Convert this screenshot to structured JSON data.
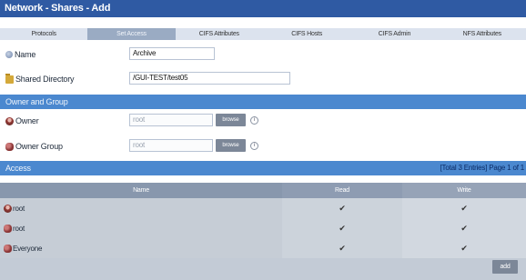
{
  "title": "Network - Shares - Add",
  "tabs": [
    {
      "label": "Protocols"
    },
    {
      "label": "Set Access"
    },
    {
      "label": "CIFS Attributes"
    },
    {
      "label": "CIFS Hosts"
    },
    {
      "label": "CIFS Admin"
    },
    {
      "label": "NFS Attributes"
    }
  ],
  "form": {
    "name_label": "Name",
    "name_value": "Archive",
    "dir_label": "Shared Directory",
    "dir_value": "/GUI-TEST/test05"
  },
  "owner_section": {
    "title": "Owner and Group",
    "owner_label": "Owner",
    "owner_value": "root",
    "group_label": "Owner Group",
    "group_value": "root",
    "browse_label": "browse"
  },
  "access": {
    "title": "Access",
    "summary": "[Total 3 Entries] Page 1 of 1",
    "columns": {
      "name": "Name",
      "read": "Read",
      "write": "Write"
    },
    "rows": [
      {
        "name": "root",
        "read": "✔",
        "write": "✔",
        "icon": "user-icon"
      },
      {
        "name": "root",
        "read": "✔",
        "write": "✔",
        "icon": "group-icon"
      },
      {
        "name": "Everyone",
        "read": "✔",
        "write": "✔",
        "icon": "group-icon"
      }
    ],
    "add_label": "add"
  }
}
